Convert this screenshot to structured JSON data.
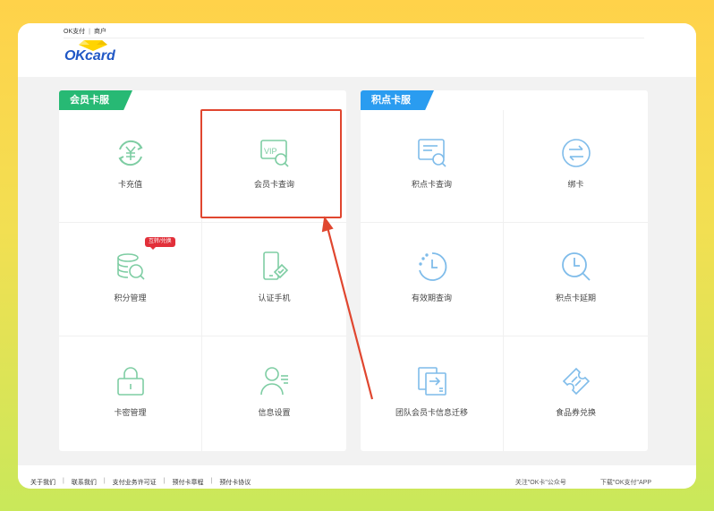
{
  "header": {
    "links": [
      "OK支付",
      "商户"
    ],
    "logo": {
      "ok": "OK",
      "card": "card"
    }
  },
  "member_panel": {
    "title": "会员卡服务",
    "items": [
      {
        "label": "卡充值",
        "icon": "yuan-cycle-icon"
      },
      {
        "label": "会员卡查询",
        "icon": "vip-card-search-icon"
      },
      {
        "label": "积分管理",
        "icon": "coins-search-icon",
        "badge": "互转/兑换"
      },
      {
        "label": "认证手机",
        "icon": "phone-verify-icon"
      },
      {
        "label": "卡密管理",
        "icon": "lock-icon"
      },
      {
        "label": "信息设置",
        "icon": "user-settings-icon"
      }
    ]
  },
  "points_panel": {
    "title": "积点卡服务",
    "items": [
      {
        "label": "积点卡查询",
        "icon": "card-search-icon"
      },
      {
        "label": "绑卡",
        "icon": "swap-arrows-icon"
      },
      {
        "label": "有效期查询",
        "icon": "clock-dashed-icon"
      },
      {
        "label": "积点卡延期",
        "icon": "clock-search-icon"
      },
      {
        "label": "团队会员卡信息迁移",
        "icon": "transfer-icon"
      },
      {
        "label": "食品券兑换",
        "icon": "coupon-icon"
      }
    ]
  },
  "footer": {
    "links": [
      "关于我们",
      "联系我们",
      "支付业务许可证",
      "预付卡章程",
      "预付卡协议"
    ],
    "right": [
      "关注\"OK卡\"公众号",
      "下载\"OK支付\"APP"
    ]
  },
  "colors": {
    "member_accent": "#27b974",
    "points_accent": "#2a9cf0",
    "highlight": "#e0462f",
    "brand_blue": "#1f57c5"
  }
}
